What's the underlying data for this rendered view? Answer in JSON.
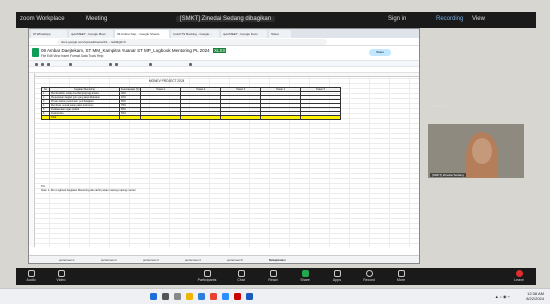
{
  "zoom": {
    "app_title": "zoom Workplace",
    "meeting_label": "Meeting",
    "share_label": "[SMKT] Zinedai Sedang dibagikan",
    "sign_in": "Sign in",
    "recording": "Recording",
    "view_label": "View"
  },
  "browser": {
    "tabs": [
      "W WhatsApp",
      "quiz/MEET - Google Meet",
      "09 Ambar Dep... Google Sheets",
      "ListLKTS Booking - Google...",
      "quiz/MEET - Google Docs",
      "Sheet"
    ],
    "url": "docs.google.com/spreadsheets/d/1..../edit#gid=0"
  },
  "sheet": {
    "title": "09 Ambar Daejtekam, ST MM_Kampitra Yuanar ST MP_Logbook Mentoring PL 2024",
    "badge": "XLSX",
    "menu": "File  Edit  View  Insert  Format  Data  Tools  Help",
    "share_button": "Share",
    "table_title": "MONEV PROJECT 2024",
    "headers": [
      "No",
      "Kegiatan Mentoring",
      "Ketercapaian (%)",
      "Pekan 1",
      "Pekan 2",
      "Pekan 3",
      "Pekan 4",
      "Pekan 5"
    ],
    "rows": [
      [
        "1",
        "Membuat/No, setiap mendamping lagi antara",
        "30%"
      ],
      [
        "2",
        "Menjelaskan bagian poin yang akan dilakukan",
        "40%"
      ],
      [
        "3",
        "Proses bahan pertemuan, pembelajaran",
        "65%"
      ],
      [
        "4",
        "Membuat, sesuai saran pakai instrumen",
        "75%"
      ],
      [
        "5",
        "Pelaksanaan tugas praktik",
        "80%"
      ],
      [
        "6",
        "Kesimpulan",
        "50%"
      ]
    ],
    "total_label": "Total",
    "notes": [
      "Ttd,",
      "Note: 1. Run Logbook Kegiatan Mentoring dan akhir pekan masing-masing mentor"
    ],
    "sheet_tabs": [
      "pertemuan 1",
      "pertemuan 2",
      "pertemuan 3",
      "pertemuan 4",
      "pertemuan 5",
      "Rekapitulasi"
    ]
  },
  "participant": {
    "name": "[SMKT] Zinedai Sedang",
    "tile_label": "Kampitra..."
  },
  "toolbar": {
    "audio": "Audio",
    "video": "Video",
    "participants": "Participants",
    "participants_count": "23",
    "chat": "Chat",
    "chat_badge": "4",
    "react": "React",
    "share": "Share",
    "apps": "Apps",
    "record": "Record",
    "more": "More",
    "leave": "Leave"
  },
  "taskbar": {
    "time": "12:38 AM",
    "date": "8/22/2024"
  },
  "colors": {
    "zoom_bar": "#1a1a1a",
    "share_green": "#22a84a",
    "leave_red": "#e02c2c",
    "total_row_yellow": "#fff200",
    "sheets_green": "#0f9d58"
  }
}
